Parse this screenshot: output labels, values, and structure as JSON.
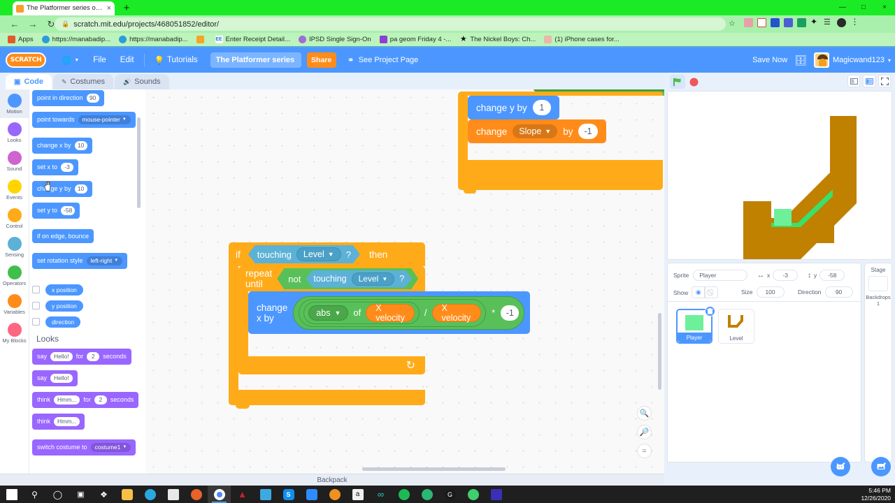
{
  "browser": {
    "tab_title": "The Platformer series on Scratch",
    "tab_close": "×",
    "new_tab": "+",
    "back": "←",
    "forward": "→",
    "reload": "↻",
    "lock": "🔒",
    "url": "scratch.mit.edu/projects/468051852/editor/",
    "star": "☆",
    "menu": "⋮",
    "minimize": "—",
    "maximize": "□",
    "close": "×",
    "bookmarks": [
      {
        "label": "Apps",
        "icon": "apps-grid-icon",
        "color": "#e05b2a"
      },
      {
        "label": "https://manabadip...",
        "icon": "globe-icon",
        "color": "#2d9cdb"
      },
      {
        "label": "https://manabadip...",
        "icon": "globe-icon",
        "color": "#2d9cdb"
      },
      {
        "label": "",
        "icon": "orange-square-icon",
        "color": "#f5a623"
      },
      {
        "label": "Enter Receipt Detail...",
        "icon": "ee-icon",
        "color": "#1b7fd4"
      },
      {
        "label": "IPSD Single Sign-On",
        "icon": "shield-icon",
        "color": "#9b6fd4"
      },
      {
        "label": "pa geom Friday 4 -...",
        "icon": "purple-doc-icon",
        "color": "#8c3fd4"
      },
      {
        "label": "The Nickel Boys: Ch...",
        "icon": "star-icon",
        "color": "#111111"
      },
      {
        "label": "(1) iPhone cases for...",
        "icon": "image-icon",
        "color": "#e8b8a8"
      }
    ]
  },
  "scratch_menu": {
    "logo": "SCRATCH",
    "globe_icon": "globe-icon",
    "file": "File",
    "edit": "Edit",
    "tutorials": "Tutorials",
    "tutorials_icon": "lightbulb-icon",
    "project_name": "The Platformer series",
    "share": "Share",
    "see_project_page": "See Project Page",
    "project_page_icon": "folder-link-icon",
    "save_now": "Save Now",
    "folder_icon": "folder-icon",
    "username": "Magicwand123",
    "user_caret": "▾"
  },
  "tabs": [
    {
      "label": "Code",
      "icon": "code-icon",
      "active": true
    },
    {
      "label": "Costumes",
      "icon": "brush-icon",
      "active": false
    },
    {
      "label": "Sounds",
      "icon": "speaker-icon",
      "active": false
    }
  ],
  "categories": [
    {
      "label": "Motion",
      "color": "#4c97ff",
      "selected": true
    },
    {
      "label": "Looks",
      "color": "#9966ff",
      "selected": false
    },
    {
      "label": "Sound",
      "color": "#cf63cf",
      "selected": false
    },
    {
      "label": "Events",
      "color": "#ffd500",
      "selected": false
    },
    {
      "label": "Control",
      "color": "#ffab19",
      "selected": false
    },
    {
      "label": "Sensing",
      "color": "#5cb1d6",
      "selected": false
    },
    {
      "label": "Operators",
      "color": "#40bf4a",
      "selected": false
    },
    {
      "label": "Variables",
      "color": "#ff8c1a",
      "selected": false
    },
    {
      "label": "My Blocks",
      "color": "#ff6680",
      "selected": false
    }
  ],
  "palette": {
    "motion_blocks": [
      {
        "id": "point-in-direction",
        "parts": [
          {
            "t": "label",
            "v": "point in direction"
          },
          {
            "t": "num",
            "v": "90"
          }
        ]
      },
      {
        "id": "point-towards",
        "parts": [
          {
            "t": "label",
            "v": "point towards"
          },
          {
            "t": "dd",
            "v": "mouse-pointer"
          }
        ]
      },
      {
        "id": "change-x-by",
        "parts": [
          {
            "t": "label",
            "v": "change x by"
          },
          {
            "t": "num",
            "v": "10"
          }
        ]
      },
      {
        "id": "set-x-to",
        "parts": [
          {
            "t": "label",
            "v": "set x to"
          },
          {
            "t": "num",
            "v": "-3"
          }
        ]
      },
      {
        "id": "change-y-by",
        "parts": [
          {
            "t": "label",
            "v": "change y by"
          },
          {
            "t": "num",
            "v": "10"
          }
        ]
      },
      {
        "id": "set-y-to",
        "parts": [
          {
            "t": "label",
            "v": "set y to"
          },
          {
            "t": "num",
            "v": "-58"
          }
        ]
      },
      {
        "id": "if-on-edge-bounce",
        "parts": [
          {
            "t": "label",
            "v": "if on edge, bounce"
          }
        ]
      },
      {
        "id": "set-rotation-style",
        "parts": [
          {
            "t": "label",
            "v": "set rotation style"
          },
          {
            "t": "dd",
            "v": "left-right"
          }
        ]
      }
    ],
    "reporters": [
      {
        "label": "x position",
        "checked": false
      },
      {
        "label": "y position",
        "checked": false
      },
      {
        "label": "direction",
        "checked": false
      }
    ],
    "looks_heading": "Looks",
    "looks_blocks": [
      {
        "id": "say-for-secs",
        "parts": [
          {
            "t": "label",
            "v": "say"
          },
          {
            "t": "txt",
            "v": "Hello!"
          },
          {
            "t": "label",
            "v": "for"
          },
          {
            "t": "num",
            "v": "2"
          },
          {
            "t": "label",
            "v": "seconds"
          }
        ]
      },
      {
        "id": "say",
        "parts": [
          {
            "t": "label",
            "v": "say"
          },
          {
            "t": "txt",
            "v": "Hello!"
          }
        ]
      },
      {
        "id": "think-for-secs",
        "parts": [
          {
            "t": "label",
            "v": "think"
          },
          {
            "t": "txt",
            "v": "Hmm..."
          },
          {
            "t": "label",
            "v": "for"
          },
          {
            "t": "num",
            "v": "2"
          },
          {
            "t": "label",
            "v": "seconds"
          }
        ]
      },
      {
        "id": "think",
        "parts": [
          {
            "t": "label",
            "v": "think"
          },
          {
            "t": "txt",
            "v": "Hmm..."
          }
        ]
      },
      {
        "id": "switch-costume",
        "parts": [
          {
            "t": "label",
            "v": "switch costume to"
          },
          {
            "t": "dd",
            "v": "costume1"
          }
        ]
      }
    ]
  },
  "workspace": {
    "script_top": {
      "change_y_by_label": "change y by",
      "change_y_by_value": "1",
      "change_label": "change",
      "change_var": "Slope",
      "by_label": "by",
      "by_value": "-1"
    },
    "script_main": {
      "if_label": "if",
      "then_label": "then",
      "touching_label": "touching",
      "touching_target": "Level",
      "question": "?",
      "repeat_until_label": "repeat until",
      "not_label": "not",
      "touching2_label": "touching",
      "touching2_target": "Level",
      "question2": "?",
      "change_x_by_label": "change x by",
      "abs_op": "abs",
      "of_label": "of",
      "operand1": "X velocity",
      "divide": "/",
      "operand2": "X velocity",
      "multiply": "*",
      "multiplier": "-1",
      "loop_arrow": "↻"
    },
    "zoom_in": "+",
    "zoom_out": "−",
    "zoom_reset": "=",
    "backpack": "Backpack"
  },
  "stage": {
    "green_flag_icon": "green-flag-icon",
    "stop_icon": "stop-sign-icon",
    "small_stage_icon": "small-stage-icon",
    "large_stage_icon": "large-stage-icon",
    "fullscreen_icon": "fullscreen-icon",
    "platform_color": "#c08000",
    "grass_color": "#3ae06a",
    "player_color": "#6ef09a"
  },
  "sprite_info": {
    "sprite_label": "Sprite",
    "sprite_name": "Player",
    "x_label": "x",
    "x_value": "-3",
    "y_label": "y",
    "y_value": "-58",
    "x_icon": "horizontal-arrows-icon",
    "y_icon": "vertical-arrows-icon",
    "show_label": "Show",
    "show_on_icon": "eye-open-icon",
    "show_off_icon": "eye-closed-icon",
    "size_label": "Size",
    "size_value": "100",
    "direction_label": "Direction",
    "direction_value": "90"
  },
  "sprites": [
    {
      "name": "Player",
      "selected": true,
      "delete_icon": "trash-icon"
    },
    {
      "name": "Level",
      "selected": false
    }
  ],
  "stage_pane": {
    "title": "Stage",
    "backdrops_label": "Backdrops",
    "backdrops_count": "1",
    "add_sprite_icon": "add-sprite-cat-icon",
    "add_backdrop_icon": "add-backdrop-icon"
  },
  "taskbar": {
    "items": [
      {
        "name": "start-button",
        "color": "#ffffff",
        "icon": "windows-icon"
      },
      {
        "name": "search-button",
        "color": "#ffffff",
        "icon": "search-icon"
      },
      {
        "name": "cortana-button",
        "color": "#ffffff",
        "icon": "circle-icon"
      },
      {
        "name": "task-view-button",
        "color": "#ffffff",
        "icon": "task-view-icon"
      },
      {
        "name": "dropbox",
        "color": "#ffffff",
        "icon": "dropbox-icon"
      },
      {
        "name": "file-explorer",
        "color": "#f5c045",
        "icon": "folder-icon"
      },
      {
        "name": "edge",
        "color": "#29a8e0",
        "icon": "edge-icon"
      },
      {
        "name": "store",
        "color": "#e8e8e8",
        "icon": "store-icon"
      },
      {
        "name": "firefox",
        "color": "#e8622a",
        "icon": "firefox-icon"
      },
      {
        "name": "chrome",
        "color": "#ffffff",
        "icon": "chrome-icon"
      },
      {
        "name": "acrobat",
        "color": "#c8202e",
        "icon": "acrobat-icon"
      },
      {
        "name": "mail",
        "color": "#3ea8e0",
        "icon": "mail-icon"
      },
      {
        "name": "skype",
        "color": "#0f8ff0",
        "icon": "skype-icon"
      },
      {
        "name": "zoom",
        "color": "#2d8cff",
        "icon": "zoom-icon"
      },
      {
        "name": "firefox-alt",
        "color": "#f09020",
        "icon": "firefox-alt-icon"
      },
      {
        "name": "amazon",
        "color": "#f0f0f0",
        "icon": "amazon-icon"
      },
      {
        "name": "infinity-app",
        "color": "#2fc4b8",
        "icon": "infinity-icon"
      },
      {
        "name": "spotify",
        "color": "#1db954",
        "icon": "spotify-icon"
      },
      {
        "name": "wifi-app",
        "color": "#2bb673",
        "icon": "signal-icon"
      },
      {
        "name": "logitech",
        "color": "#1a1a1a",
        "icon": "logitech-g-icon"
      },
      {
        "name": "satellite-app",
        "color": "#3fcf6f",
        "icon": "satellite-icon"
      },
      {
        "name": "blue-app",
        "color": "#3b2fb8",
        "icon": "square-app-icon"
      }
    ],
    "time": "5:46 PM",
    "date": "12/26/2020"
  }
}
